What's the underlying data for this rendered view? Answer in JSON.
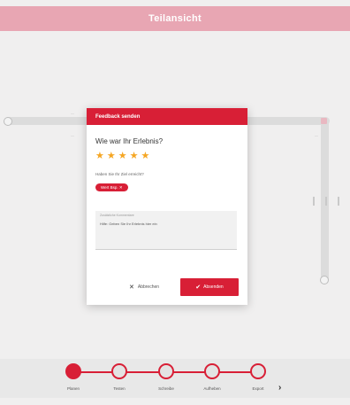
{
  "header": {
    "title": "Teilansicht"
  },
  "background": {
    "tick_labels": [
      "—",
      "—",
      "—"
    ]
  },
  "dialog": {
    "title": "Feedback senden",
    "question": "Wie war Ihr Erlebnis?",
    "rating": {
      "value": 5,
      "max": 5,
      "star_glyph": "★",
      "star_color": "#f5a623"
    },
    "subquestion": "Haben Sie Ihr Ziel erreicht?",
    "chip_label": "Wert Bsp. ✕",
    "textarea_label": "Zusätzliche Kommentare",
    "textarea_value": "Hilfe: Geben Sie Ihr Erlebnis hier ein",
    "cancel_label": "Abbrechen",
    "send_label": "Absenden"
  },
  "stepper": {
    "steps": [
      {
        "label": "Planen",
        "active": true
      },
      {
        "label": "Testen",
        "active": false
      },
      {
        "label": "Schreibe",
        "active": false
      },
      {
        "label": "Aufheben",
        "active": false
      },
      {
        "label": "Export",
        "active": false
      }
    ],
    "next_glyph": "›"
  },
  "colors": {
    "accent": "#d81f36",
    "header_bg": "#e8a6b3",
    "page_bg": "#f0efef"
  }
}
